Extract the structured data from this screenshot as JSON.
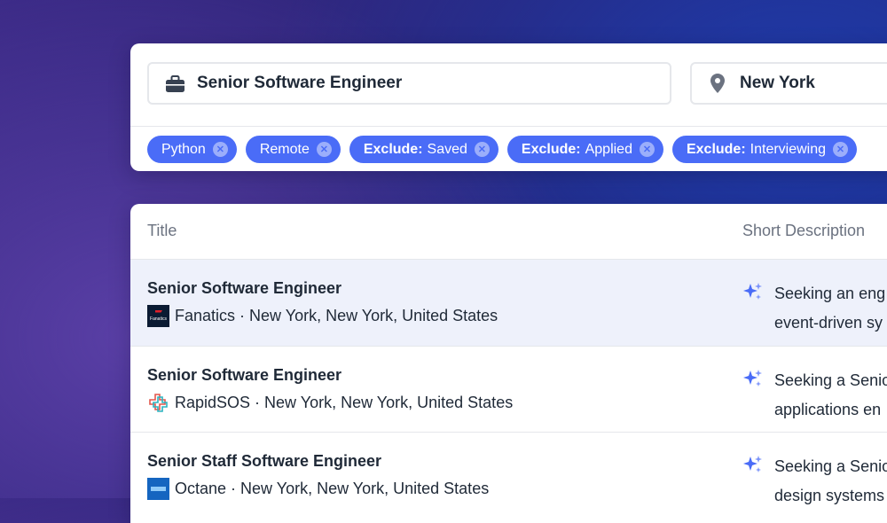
{
  "search": {
    "title_value": "Senior Software Engineer",
    "location_value": "New York"
  },
  "filters": [
    {
      "bold": "",
      "label": "Python"
    },
    {
      "bold": "",
      "label": "Remote"
    },
    {
      "bold": "Exclude:",
      "label": "Saved"
    },
    {
      "bold": "Exclude:",
      "label": "Applied"
    },
    {
      "bold": "Exclude:",
      "label": "Interviewing"
    }
  ],
  "table": {
    "columns": [
      "Title",
      "Short Description"
    ],
    "rows": [
      {
        "title": "Senior Software Engineer",
        "company": "Fanatics",
        "location": "New York, New York, United States",
        "logo_text": "Fanatics",
        "desc_line1": "Seeking an eng",
        "desc_line2": "event-driven sy"
      },
      {
        "title": "Senior Software Engineer",
        "company": "RapidSOS",
        "location": "New York, New York, United States",
        "logo_text": "",
        "desc_line1": "Seeking a Senio",
        "desc_line2": "applications en"
      },
      {
        "title": "Senior Staff Software Engineer",
        "company": "Octane",
        "location": "New York, New York, United States",
        "logo_text": "",
        "desc_line1": "Seeking a Senio",
        "desc_line2": "design systems"
      }
    ]
  },
  "colors": {
    "chip_bg": "#4a6cf7",
    "sparkle": "#4a6cf7",
    "row_highlight": "#eef1fb"
  },
  "icons": {
    "title_field": "briefcase-icon",
    "location_field": "map-pin-icon",
    "chip_remove": "close-icon",
    "ai_summary": "sparkle-icon"
  }
}
